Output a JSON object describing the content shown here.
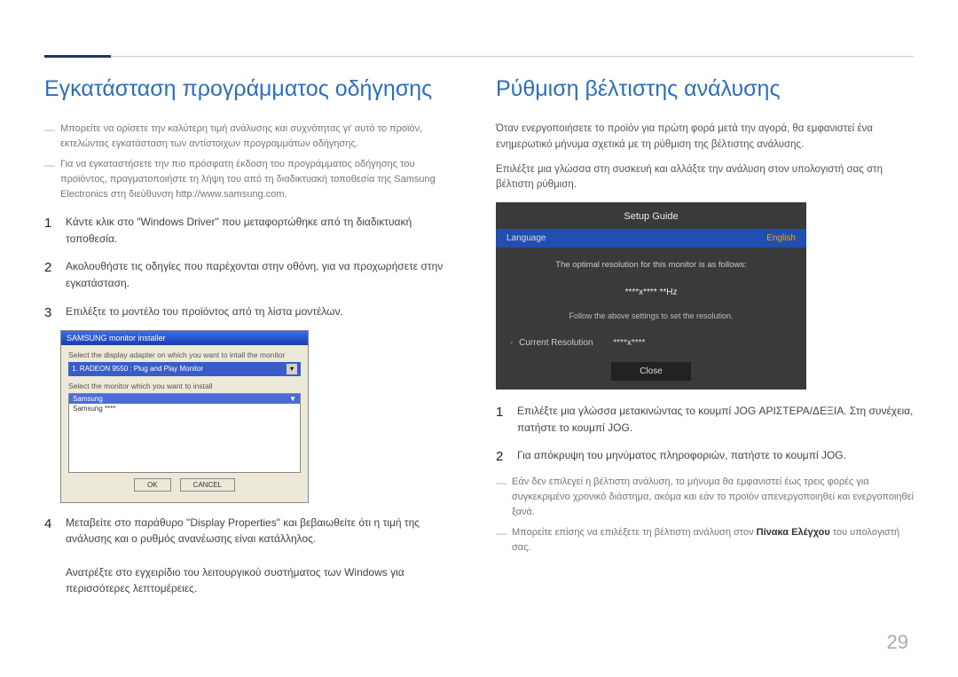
{
  "page_number": "29",
  "left": {
    "heading": "Εγκατάσταση προγράμματος οδήγησης",
    "notes": [
      "Μπορείτε να ορίσετε την καλύτερη τιμή ανάλυσης και συχνότητας γι' αυτό το προϊόν, εκτελώντας εγκατάσταση των αντίστοιχων προγραμμάτων οδήγησης.",
      "Για να εγκαταστήσετε την πιο πρόσφατη έκδοση του προγράμματος οδήγησης του προϊόντος, πραγματοποιήστε τη λήψη του από τη διαδικτυακή τοποθεσία της Samsung Electronics στη διεύθυνση http://www.samsung.com."
    ],
    "steps": {
      "s1": "Κάντε κλικ στο \"Windows Driver\" που μεταφορτώθηκε από τη διαδικτυακή τοποθεσία.",
      "s2": "Ακολουθήστε τις οδηγίες που παρέχονται στην οθόνη, για να προχωρήσετε στην εγκατάσταση.",
      "s3": "Επιλέξτε το μοντέλο του προϊόντος από τη λίστα μοντέλων.",
      "s4a": "Μεταβείτε στο παράθυρο \"Display Properties\" και βεβαιωθείτε ότι η τιμή της ανάλυσης και ο ρυθμός ανανέωσης είναι κατάλληλος.",
      "s4b": "Ανατρέξτε στο εγχειρίδιο του λειτουργικού συστήματος των Windows για περισσότερες λεπτομέρειες."
    },
    "installer": {
      "title": "SAMSUNG monitor installer",
      "line1": "Select the display adapter on which you want to intall the monitor",
      "adapter": "1. RADEON 9550 : Plug and Play Monitor",
      "line2": "Select the monitor which you want to install",
      "list_header_left": "Samsung",
      "list_header_right": "▼",
      "item1": "Samsung ****",
      "ok": "OK",
      "cancel": "CANCEL"
    }
  },
  "right": {
    "heading": "Ρύθμιση βέλτιστης ανάλυσης",
    "p1": "Όταν ενεργοποιήσετε το προϊόν για πρώτη φορά μετά την αγορά, θα εμφανιστεί ένα ενημερωτικό μήνυμα σχετικά με τη ρύθμιση της βέλτιστης ανάλυσης.",
    "p2": "Επιλέξτε μια γλώσσα στη συσκευή και αλλάξτε την ανάλυση στον υπολογιστή σας στη βέλτιστη ρύθμιση.",
    "osd": {
      "title": "Setup Guide",
      "lang_label": "Language",
      "lang_value": "English",
      "info": "The optimal resolution for this monitor is as follows:",
      "res": "****x**** **Hz",
      "follow": "Follow the above settings to set the resolution.",
      "cur_label": "Current Resolution",
      "cur_value": "****x****",
      "close": "Close"
    },
    "steps": {
      "s1": "Επιλέξτε μια γλώσσα μετακινώντας το κουμπί JOG ΑΡΙΣΤΕΡΑ/ΔΕΞΙΑ. Στη συνέχεια, πατήστε το κουμπί JOG.",
      "s2": "Για απόκρυψη του μηνύματος πληροφοριών, πατήστε το κουμπί JOG."
    },
    "notes": [
      "Εάν δεν επιλεγεί η βέλτιστη ανάλυση, το μήνυμα θα εμφανιστεί έως τρεις φορές για συγκεκριμένο χρονικό διάστημα, ακόμα και εάν το προϊόν απενεργοποιηθεί και ενεργοποιηθεί ξανά."
    ],
    "note2_pre": "Μπορείτε επίσης να επιλέξετε τη βέλτιστη ανάλυση στον ",
    "note2_bold": "Πίνακα Ελέγχου",
    "note2_post": " του υπολογιστή σας."
  }
}
